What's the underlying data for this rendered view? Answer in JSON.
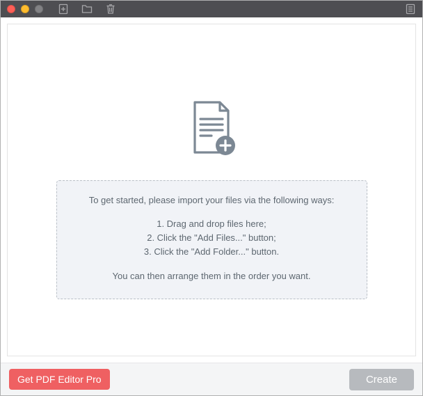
{
  "instructions": {
    "intro": "To get started, please import your files via the following ways:",
    "step1": "1. Drag and drop files here;",
    "step2": "2. Click the \"Add Files...\" button;",
    "step3": "3. Click the \"Add Folder...\" button.",
    "outro": "You can then arrange them in the order you want."
  },
  "footer": {
    "pro_button": "Get PDF Editor Pro",
    "create_button": "Create"
  }
}
